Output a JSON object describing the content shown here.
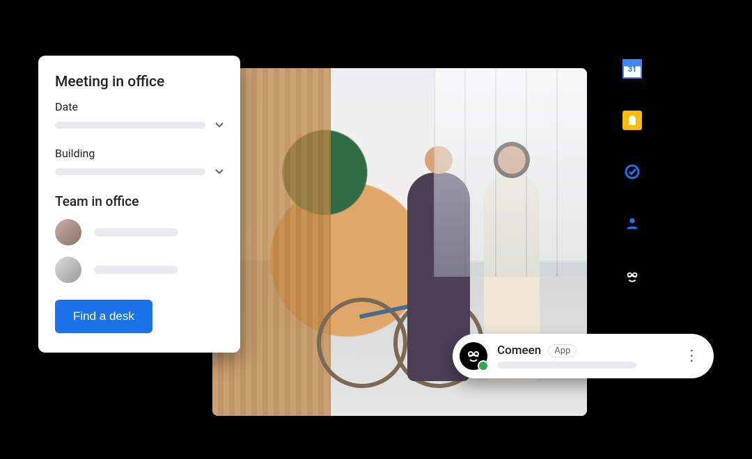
{
  "panel": {
    "title": "Meeting in office",
    "date_label": "Date",
    "building_label": "Building",
    "team_title": "Team in office",
    "button_label": "Find a desk"
  },
  "chip": {
    "name": "Comeen",
    "badge": "App",
    "status": "online"
  },
  "rail": {
    "icons": [
      {
        "name": "calendar-icon",
        "label": "31"
      },
      {
        "name": "keep-icon"
      },
      {
        "name": "tasks-icon"
      },
      {
        "name": "contacts-icon"
      },
      {
        "name": "comeen-app-icon"
      }
    ]
  },
  "colors": {
    "primary": "#1a73e8",
    "accent": "#fbbc04",
    "success": "#34a853"
  }
}
